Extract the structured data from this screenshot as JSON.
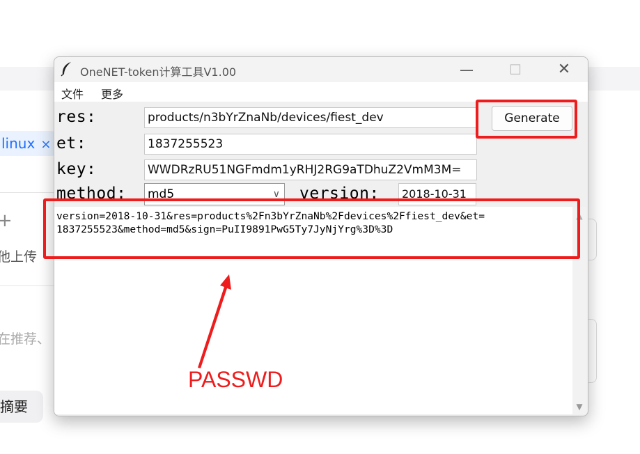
{
  "background_page": {
    "tag_label": "linux",
    "tag_close": "×",
    "upload_text": "他上传",
    "recommend_text": "在推荐、",
    "summary_button": "摘要",
    "plus_icon": "+"
  },
  "window": {
    "title": "OneNET-token计算工具V1.00",
    "controls": {
      "minimize": "—",
      "maximize": "☐",
      "close": "✕"
    },
    "menu": [
      "文件",
      "更多"
    ]
  },
  "form": {
    "res_label": "res:",
    "res_value": "products/n3bYrZnaNb/devices/fiest_dev",
    "et_label": "et:",
    "et_value": "1837255523",
    "key_label": "key:",
    "key_value": "WWDRzRU51NGFmdm1yRHJ2RG9aTDhuZ2VmM3M=",
    "method_label": "method:",
    "method_value": "md5",
    "version_label": "version:",
    "version_value": "2018-10-31",
    "generate_label": "Generate"
  },
  "output": {
    "line1": "version=2018-10-31&res=products%2Fn3bYrZnaNb%2Fdevices%2Ffiest_dev&et=",
    "line2": "1837255523&method=md5&sign=PuII9891PwG5Ty7JyNjYrg%3D%3D"
  },
  "annotation": {
    "label": "PASSWD",
    "color": "#ee1c1c"
  }
}
